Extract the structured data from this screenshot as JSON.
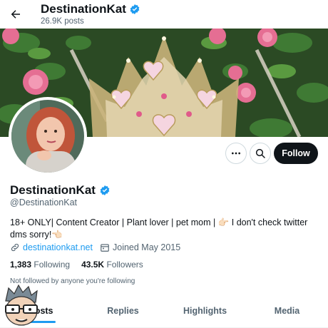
{
  "header": {
    "name": "DestinationKat",
    "posts": "26.9K posts"
  },
  "profile": {
    "display_name": "DestinationKat",
    "handle": "@DestinationKat",
    "bio": "18+ ONLY| Content Creator | Plant lover | pet mom | 👉🏻 I don't check twitter dms sorry!👈🏻",
    "website": "destinationkat.net",
    "joined": "Joined May 2015",
    "following_count": "1,383",
    "following_label": "Following",
    "followers_count": "43.5K",
    "followers_label": "Followers",
    "not_followed": "Not followed by anyone you're following"
  },
  "actions": {
    "follow_label": "Follow"
  },
  "tabs": [
    {
      "label": "Posts",
      "active": true
    },
    {
      "label": "Replies",
      "active": false
    },
    {
      "label": "Highlights",
      "active": false
    },
    {
      "label": "Media",
      "active": false
    }
  ],
  "colors": {
    "accent": "#1d9bf0",
    "verified": "#1d9bf0",
    "text_primary": "#0f1419",
    "text_secondary": "#536471",
    "follow_button": "#0f1419"
  },
  "icons": {
    "back": "arrow-left-icon",
    "verified": "verified-badge-icon",
    "more": "more-horizontal-icon",
    "search": "search-icon",
    "link": "link-icon",
    "calendar": "calendar-icon"
  }
}
